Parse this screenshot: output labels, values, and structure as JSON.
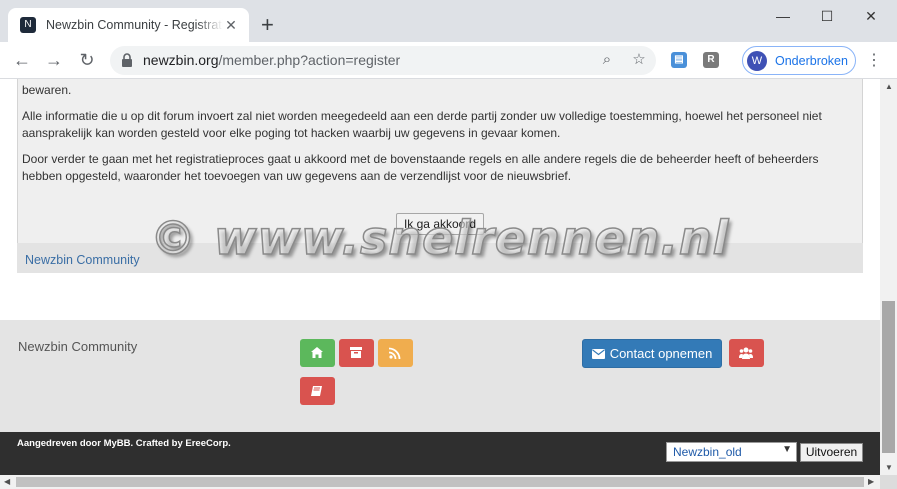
{
  "browser": {
    "tab_title": "Newzbin Community - Registratie",
    "tab_favicon": "N",
    "url_host": "newzbin.org",
    "url_path": "/member.php?action=register",
    "profile_initial": "W",
    "profile_label": "Onderbroken",
    "ext_r_label": "R"
  },
  "page": {
    "rules_paragraphs": [
      "bewaren.",
      "Alle informatie die u op dit forum invoert zal niet worden meegedeeld aan een derde partij zonder uw volledige toestemming, hoewel het personeel niet aansprakelijk kan worden gesteld voor elke poging tot hacken waarbij uw gegevens in gevaar komen.",
      "Door verder te gaan met het registratieproces gaat u akkoord met de bovenstaande regels en alle andere regels die de beheerder heeft of beheerders hebben opgesteld, waaronder het toevoegen van uw gegevens aan de verzendlijst voor de nieuwsbrief."
    ],
    "agree_button": "Ik ga akkoord",
    "breadcrumb": "Newzbin Community",
    "watermark": "© www.snelrennen.nl"
  },
  "footer": {
    "title": "Newzbin Community",
    "buttons": [
      {
        "icon": "home-icon",
        "color": "#5cb85c"
      },
      {
        "icon": "archive-icon",
        "color": "#d9534f"
      },
      {
        "icon": "rss-icon",
        "color": "#f0ad4e"
      },
      {
        "icon": "book-icon",
        "color": "#d9534f"
      },
      {
        "icon": "users-icon",
        "color": "#d9534f"
      }
    ],
    "contact_label": "Contact opnemen",
    "powered_by": "Aangedreven door MyBB. Crafted by EreeCorp.",
    "theme_selected": "Newzbin_old",
    "go_label": "Uitvoeren"
  }
}
